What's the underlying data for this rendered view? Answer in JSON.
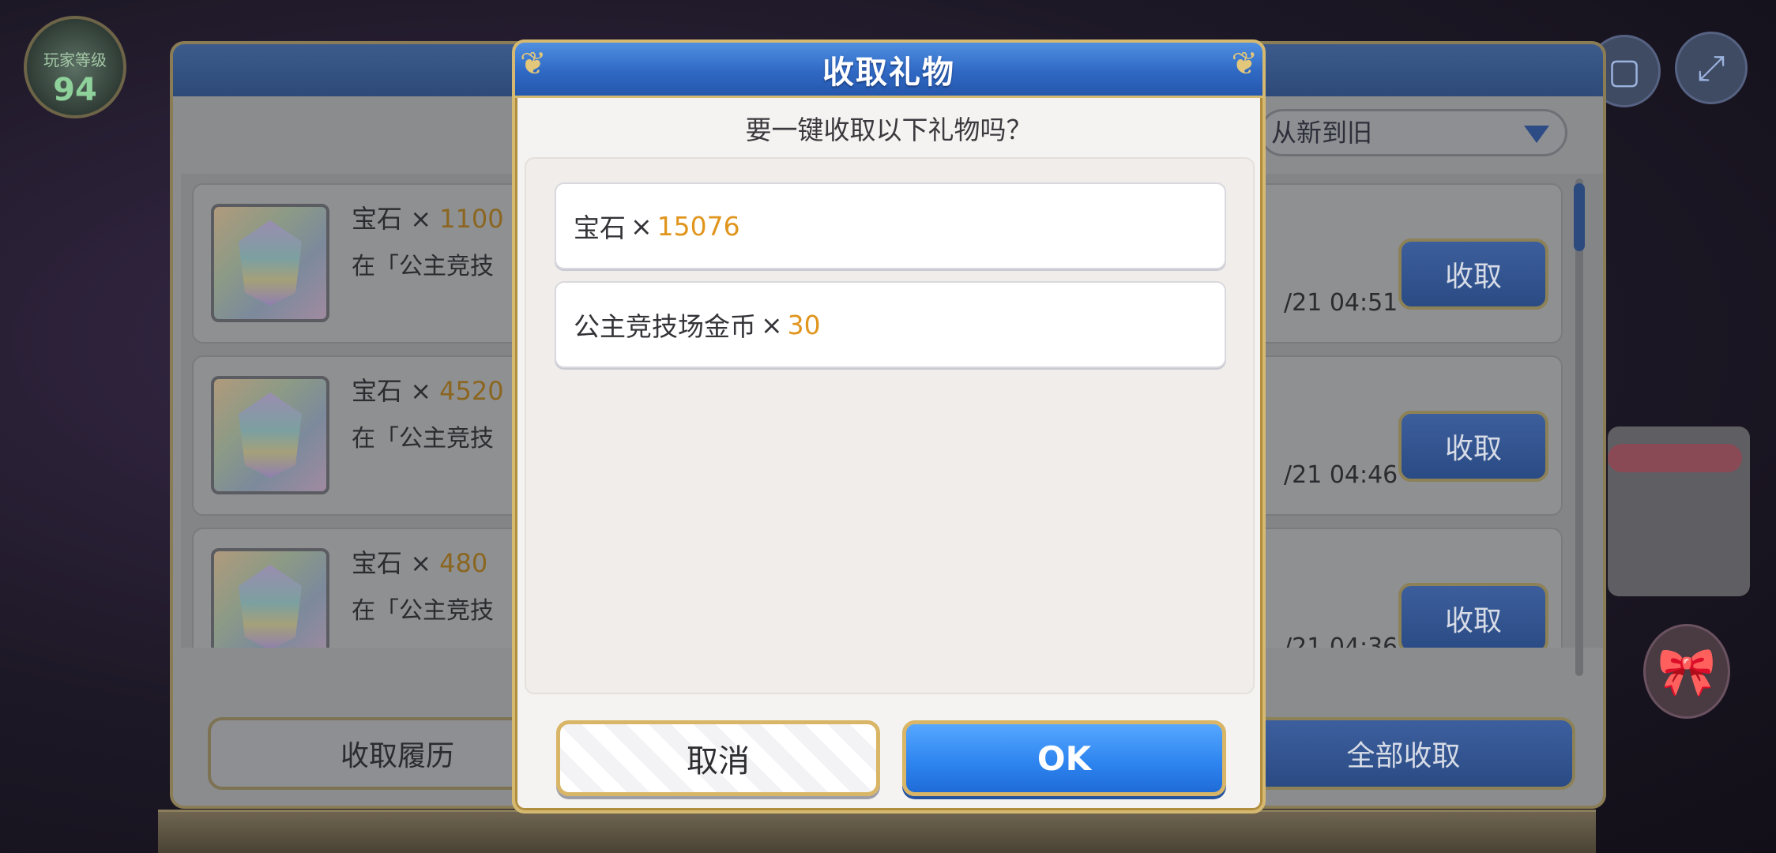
{
  "player": {
    "level_label": "玩家等级",
    "level": "94"
  },
  "background_panel": {
    "sort_label": "从新到旧",
    "gift_items": [
      {
        "name": "宝石",
        "times": "×",
        "qty": "1100",
        "desc": "在「公主竞技",
        "date": "/21 04:51",
        "button": "收取"
      },
      {
        "name": "宝石",
        "times": "×",
        "qty": "4520",
        "desc": "在「公主竞技",
        "date": "/21 04:46",
        "button": "收取"
      },
      {
        "name": "宝石",
        "times": "×",
        "qty": "480",
        "desc": "在「公主竞技",
        "date": "/21 04:36",
        "button": "收取"
      }
    ],
    "history_button": "收取履历",
    "receive_all_button": "全部收取"
  },
  "dialog": {
    "title": "收取礼物",
    "question": "要一键收取以下礼物吗？",
    "rewards": [
      {
        "name": "宝石",
        "times": "×",
        "qty": "15076"
      },
      {
        "name": "公主竞技场金币",
        "times": "×",
        "qty": "30"
      }
    ],
    "cancel_label": "取消",
    "ok_label": "OK"
  },
  "colors": {
    "dialog_header": "#2f69c4",
    "gold_border": "#d6b970",
    "quantity": "#e0951d",
    "ok_button": "#2f86f0"
  },
  "icons": {
    "gem": "gem-icon",
    "expand": "expand-icon",
    "window": "window-icon",
    "gift": "gift-icon"
  }
}
